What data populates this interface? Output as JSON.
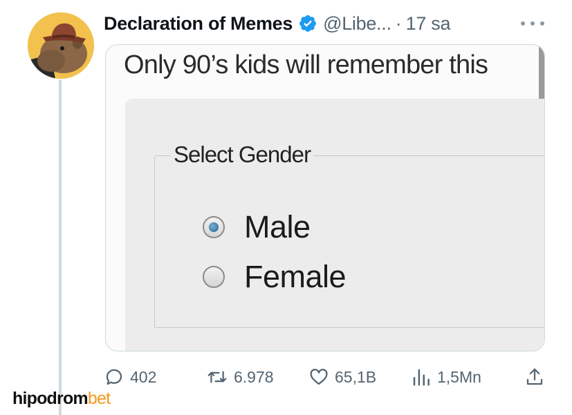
{
  "tweet": {
    "display_name": "Declaration of Memes",
    "handle": "@Libe...",
    "separator": "·",
    "time": "17 sa",
    "verified": true
  },
  "media": {
    "caption": "Only 90’s kids will remember this",
    "group_label": "Select Gender",
    "options": [
      {
        "label": "Male",
        "checked": true
      },
      {
        "label": "Female",
        "checked": false
      }
    ]
  },
  "actions": {
    "reply_count": "402",
    "retweet_count": "6.978",
    "like_count": "65,1B",
    "views_count": "1,5Mn"
  },
  "watermark": {
    "part1": "hipodrom",
    "part2": "bet"
  },
  "colors": {
    "verified_blue": "#1d9bf0",
    "secondary_text": "#536471",
    "watermark_accent": "#f39a1e"
  }
}
